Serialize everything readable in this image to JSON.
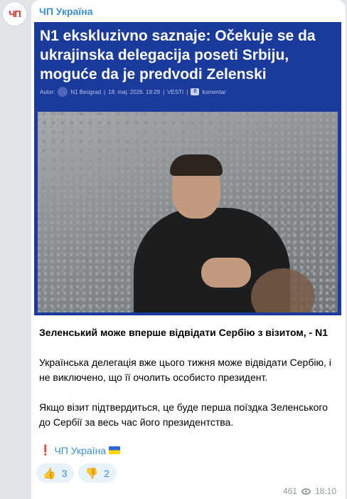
{
  "channel": {
    "avatar_text": "ЧП",
    "name": "ЧП Україна"
  },
  "link_preview": {
    "title": "N1 ekskluzivno saznaje: Očekuje se da ukrajinska delegacija poseti Srbiju, moguće da je predvodi Zelenski",
    "meta": {
      "author_label": "Autor:",
      "author": "N1 Beograd",
      "date": "18. maj. 2026. 19:29",
      "section": "VESTI",
      "comments_count": "0",
      "comments_label": "komentar"
    }
  },
  "message": {
    "title": "Зеленський може вперше відвідати Сербію з візитом, - N1",
    "paragraph1": "Українська делегація вже цього тижня може відвідати Сербію, і не виключено, що її очолить особисто президент.",
    "paragraph2": "Якщо візит підтвердиться, це буде перша поїздка Зеленського до Сербії за весь час його президентства.",
    "signature_mark": "❗",
    "signature": "ЧП Україна"
  },
  "reactions": [
    {
      "emoji": "👍",
      "icon": "thumbs-up-icon",
      "count": "3"
    },
    {
      "emoji": "👎",
      "icon": "thumbs-down-icon",
      "count": "2"
    }
  ],
  "footer": {
    "views": "461",
    "time": "18:10"
  },
  "colors": {
    "accent": "#3a8fd1",
    "preview_bg": "#1a3a9c",
    "background": "#dfe5e9"
  }
}
